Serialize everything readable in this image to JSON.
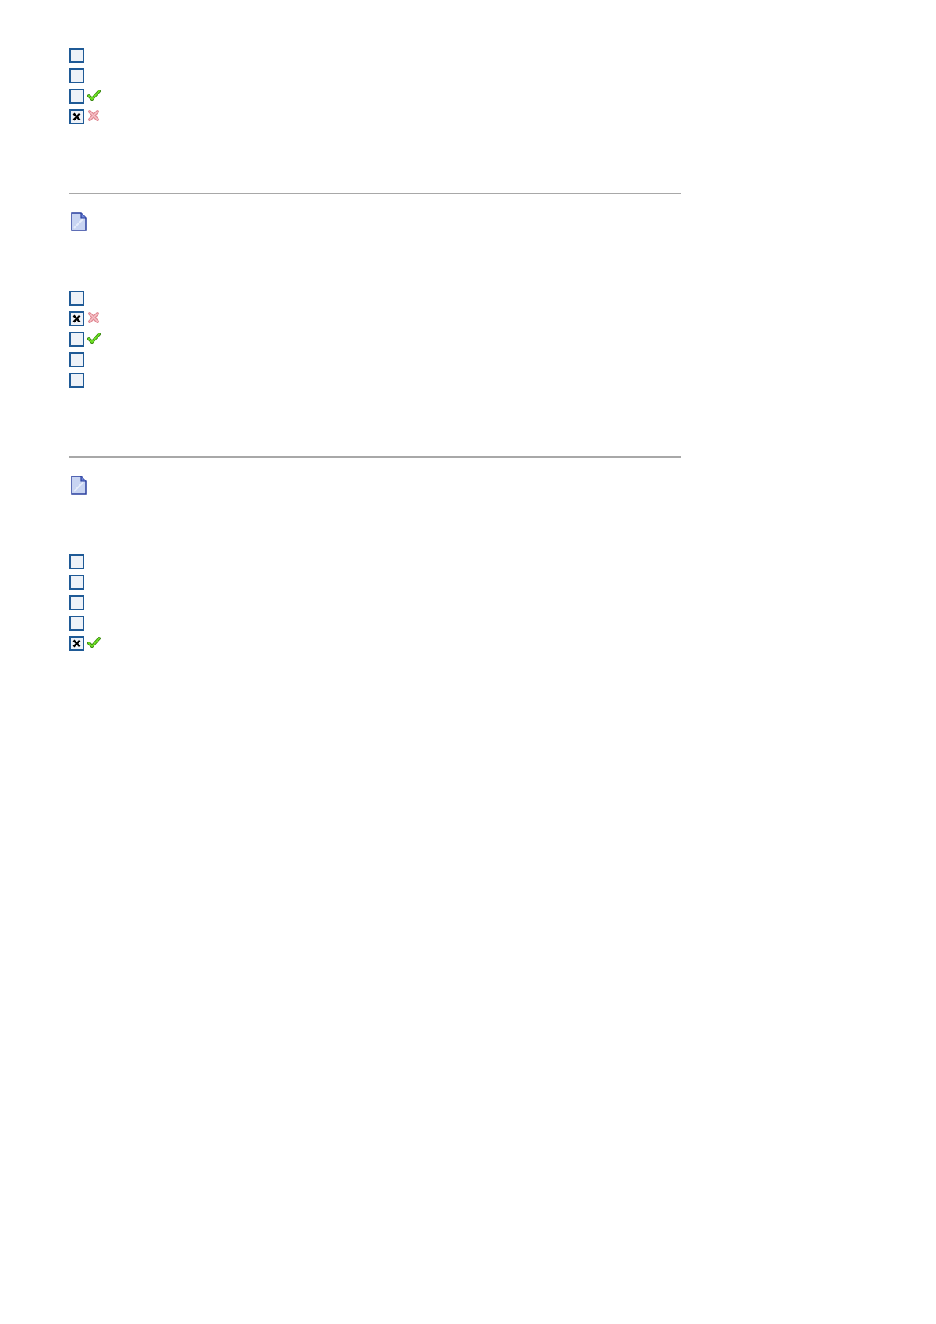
{
  "questions": [
    {
      "document_icon": false,
      "options": [
        {
          "kind": "plain",
          "checked": false
        },
        {
          "kind": "plain",
          "checked": false
        },
        {
          "kind": "right",
          "checked": false
        },
        {
          "kind": "wrong",
          "checked": true
        }
      ]
    },
    {
      "document_icon": true,
      "options": [
        {
          "kind": "plain",
          "checked": false
        },
        {
          "kind": "wrong",
          "checked": true
        },
        {
          "kind": "right",
          "checked": false
        },
        {
          "kind": "plain",
          "checked": false
        },
        {
          "kind": "plain",
          "checked": false
        }
      ]
    },
    {
      "document_icon": true,
      "options": [
        {
          "kind": "plain",
          "checked": false
        },
        {
          "kind": "plain",
          "checked": false
        },
        {
          "kind": "plain",
          "checked": false
        },
        {
          "kind": "plain",
          "checked": false
        },
        {
          "kind": "right",
          "checked": true
        }
      ]
    }
  ]
}
